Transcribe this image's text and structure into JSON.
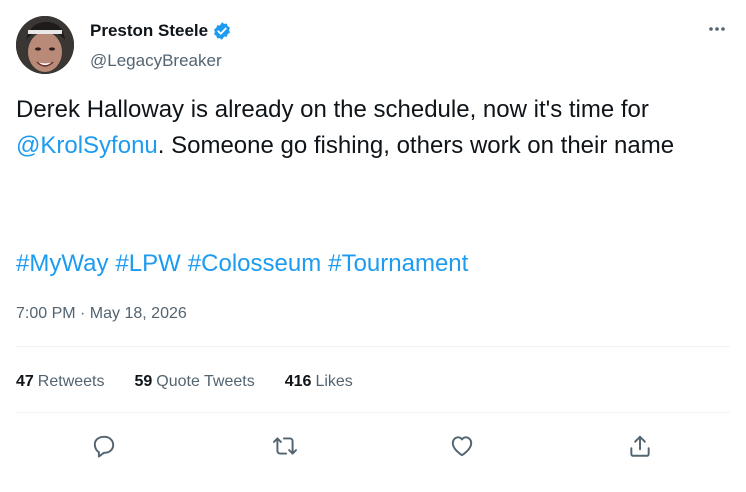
{
  "author": {
    "display_name": "Preston Steele",
    "handle": "@LegacyBreaker",
    "verified": true
  },
  "tweet": {
    "text_parts": [
      "Derek Halloway is already on the schedule, now it's time for ",
      "@KrolSyfonu",
      ". Someone go fishing, others work on their name"
    ],
    "hashtags": [
      "#MyWay",
      "#LPW",
      "#Colosseum",
      "#Tournament"
    ],
    "time": "7:00 PM · May 18, 2026"
  },
  "stats": {
    "retweets": {
      "count": "47",
      "label": "Retweets"
    },
    "quotes": {
      "count": "59",
      "label": "Quote Tweets"
    },
    "likes": {
      "count": "416",
      "label": "Likes"
    }
  },
  "icons": {
    "more": "more-icon",
    "reply": "reply-icon",
    "retweet": "retweet-icon",
    "like": "like-icon",
    "share": "share-icon",
    "verified": "verified-badge-icon"
  },
  "colors": {
    "link": "#1d9bf0",
    "text": "#0f1419",
    "secondary": "#536471",
    "divider": "#eff3f4"
  }
}
